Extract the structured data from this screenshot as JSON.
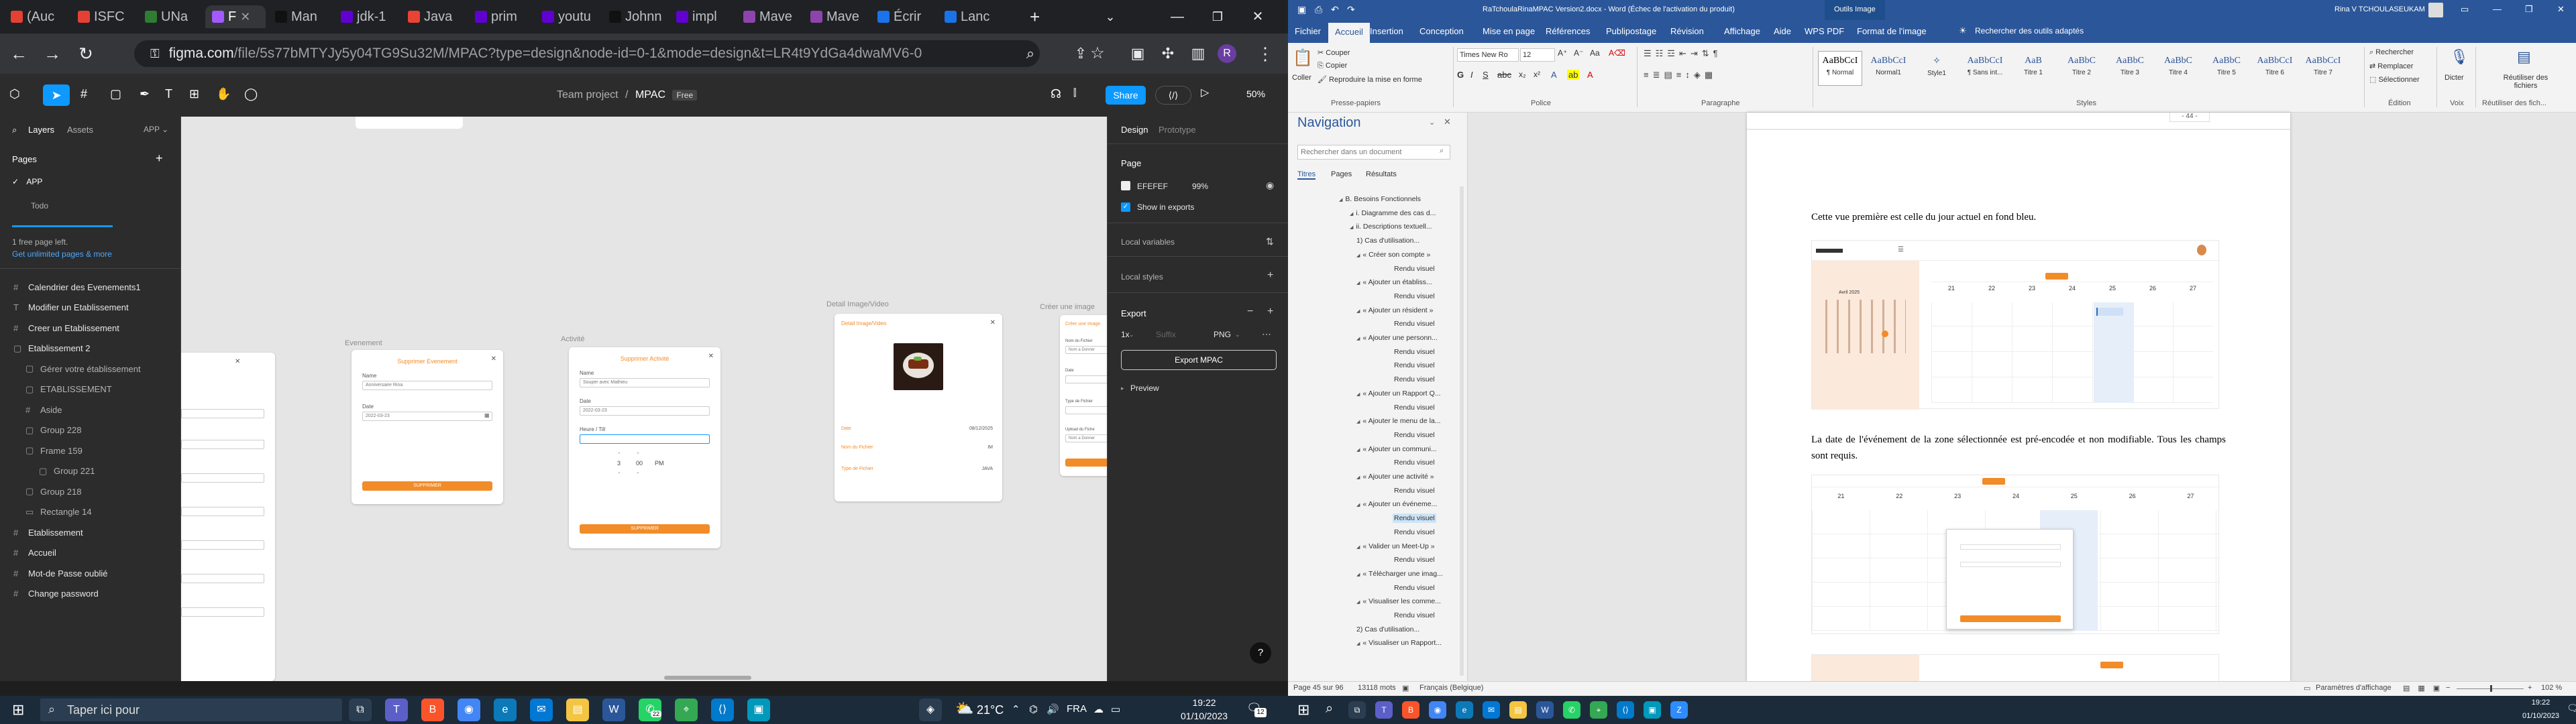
{
  "chrome": {
    "tabs": [
      {
        "label": "(Auc",
        "color": "#e44134"
      },
      {
        "label": "ISFC",
        "color": "#e44134"
      },
      {
        "label": "UNa",
        "color": "#2e7d32"
      },
      {
        "label": "F",
        "color": "#a259ff"
      },
      {
        "label": "Man",
        "color": "#111111"
      },
      {
        "label": "jdk-1",
        "color": "#6001d2"
      },
      {
        "label": "Java",
        "color": "#ea4335"
      },
      {
        "label": "prim",
        "color": "#6001d2"
      },
      {
        "label": "youtu",
        "color": "#6001d2"
      },
      {
        "label": "Johnn",
        "color": "#111111"
      },
      {
        "label": "impl",
        "color": "#6001d2"
      },
      {
        "label": "Mave",
        "color": "#8e44ad"
      },
      {
        "label": "Mave",
        "color": "#8e44ad"
      },
      {
        "label": "Écrir",
        "color": "#1a73e8"
      },
      {
        "label": "Lanc",
        "color": "#1a73e8"
      }
    ],
    "new_tab": "+",
    "url_main": "figma.com",
    "url_rest": "/file/5s77bMTYJy5y04TG9Su32M/MPAC?type=design&node-id=0-1&mode=design&t=LR4t9YdGa4dwaMV6-0",
    "window_min": "—",
    "window_max": "❐",
    "window_close": "✕"
  },
  "figma": {
    "breadcrumb_team": "Team project",
    "breadcrumb_sep": "/",
    "file_name": "MPAC",
    "plan_badge": "Free",
    "share_label": "Share",
    "avatar_letter": "Y",
    "zoom": "50%",
    "left": {
      "tab_layers": "Layers",
      "tab_assets": "Assets",
      "app_select": "APP",
      "pages_title": "Pages",
      "pages": [
        "APP",
        "Todo"
      ],
      "free_left": "1 free page left.",
      "upgrade_link": "Get unlimited pages & more",
      "layers": [
        {
          "label": "Calendrier des Evenements1",
          "level": 0
        },
        {
          "label": "Modifier un Etablissement",
          "level": 0
        },
        {
          "label": "Creer un Etablissement",
          "level": 0
        },
        {
          "label": "Etablissement 2",
          "level": 0
        },
        {
          "label": "Gérer votre établissement",
          "level": 1
        },
        {
          "label": "ETABLISSEMENT",
          "level": 1
        },
        {
          "label": "Aside",
          "level": 1
        },
        {
          "label": "Group 228",
          "level": 1
        },
        {
          "label": "Frame 159",
          "level": 1
        },
        {
          "label": "Group 221",
          "level": 2
        },
        {
          "label": "Group 218",
          "level": 1
        },
        {
          "label": "Rectangle 14",
          "level": 1
        },
        {
          "label": "Etablissement",
          "level": 0
        },
        {
          "label": "Accueil",
          "level": 0
        },
        {
          "label": "Mot-de Passe oublié",
          "level": 0
        },
        {
          "label": "Change password",
          "level": 0
        }
      ]
    },
    "canvas": {
      "frame_evenement": "Evenement",
      "frame_activite": "Activité",
      "frame_detail": "Detail Image/Video",
      "frame_creer": "Créer une image",
      "modal_event": {
        "title": "Supprimer Evenement",
        "name_label": "Name",
        "name_value": "Anniversaire Rina",
        "date_label": "Date",
        "date_value": "2022-03-23",
        "button": "SUPPRIMER"
      },
      "modal_activite": {
        "title": "Supprimer Activité",
        "name_label": "Name",
        "name_value": "Souper avec Mathieu",
        "date_label": "Date",
        "date_value": "2022-03-23",
        "hour_label": "Heure / Till",
        "time_h": "3",
        "time_m": "00",
        "time_p": "PM",
        "button": "SUPPRIMER"
      },
      "detail": {
        "title": "Detail Image/Video",
        "date_label": "Date",
        "date_value": "08/12/2025",
        "nom_label": "Nom du Fichier",
        "nom_value": "IM",
        "type_label": "Type de Fichier",
        "type_value": "JAVA"
      },
      "creer": {
        "title": "Créer une image",
        "nom_label": "Nom du Fichier",
        "nom_placeholder": "Nom a Donner",
        "date_label": "Date",
        "type_label": "Type de Fichier",
        "upload_label": "Upload du Fiche",
        "upload_placeholder": "Nom a Donner"
      }
    },
    "right": {
      "tab_design": "Design",
      "tab_prototype": "Prototype",
      "page_title": "Page",
      "page_color": "EFEFEF",
      "page_opacity": "99%",
      "show_exports": "Show in exports",
      "local_variables": "Local variables",
      "local_styles": "Local styles",
      "export_title": "Export",
      "export_scale": "1x",
      "export_suffix": "Suffix",
      "export_format": "PNG",
      "export_button": "Export MPAC",
      "preview": "Preview",
      "help": "?"
    }
  },
  "taskbar": {
    "search_placeholder": "Taper ici pour",
    "weather": "21°C",
    "lang": "FRA",
    "time_left": "19:22",
    "date_left": "01/10/2023",
    "notif_count": "22",
    "notif_badge": "12",
    "time_right": "19:22",
    "date_right": "01/10/2023"
  },
  "word": {
    "title": "RaTchoulaRinaMPAC Version2.docx - Word (Échec de l'activation du produit)",
    "context_tab": "Outils Image",
    "user_name": "Rina V TCHOULASEUKAM",
    "tabs": [
      "Fichier",
      "Accueil",
      "Insertion",
      "Conception",
      "Mise en page",
      "Références",
      "Publipostage",
      "Révision",
      "Affichage",
      "Aide",
      "WPS PDF",
      "Format de l'image"
    ],
    "tell_me": "Rechercher des outils adaptés",
    "ribbon": {
      "paste": "Coller",
      "cut": "Couper",
      "copy": "Copier",
      "format_painter": "Reproduire la mise en forme",
      "clipboard": "Presse-papiers",
      "font_name": "Times New Ro",
      "font_size": "12",
      "font_group": "Police",
      "para_group": "Paragraphe",
      "styles_group": "Styles",
      "edit_group": "Édition",
      "voice_group": "Voix",
      "reuse_group": "Réutiliser des fich...",
      "find": "Rechercher",
      "replace": "Remplacer",
      "select": "Sélectionner",
      "dictate": "Dicter",
      "reuse": "Réutiliser des fichiers",
      "styles": [
        {
          "sample": "AaBbCcI",
          "name": "¶ Normal"
        },
        {
          "sample": "AaBbCcI",
          "name": "Normal1"
        },
        {
          "sample": "✧",
          "name": "Style1"
        },
        {
          "sample": "AaBbCcI",
          "name": "¶ Sans int..."
        },
        {
          "sample": "AaB",
          "name": "Titre 1"
        },
        {
          "sample": "AaBbC",
          "name": "Titre 2"
        },
        {
          "sample": "AaBbC",
          "name": "Titre 3"
        },
        {
          "sample": "AaBbC",
          "name": "Titre 4"
        },
        {
          "sample": "AaBbC",
          "name": "Titre 5"
        },
        {
          "sample": "AaBbCcI",
          "name": "Titre 6"
        },
        {
          "sample": "AaBbCcI",
          "name": "Titre 7"
        }
      ]
    },
    "nav": {
      "title": "Navigation",
      "search_placeholder": "Rechercher dans un document",
      "tab_titles": "Titres",
      "tab_pages": "Pages",
      "tab_results": "Résultats",
      "items": [
        {
          "label": "B. Besoins Fonctionnels",
          "level": 1
        },
        {
          "label": "i. Diagramme des cas d...",
          "level": 2
        },
        {
          "label": "ii. Descriptions textuell...",
          "level": 2
        },
        {
          "label": "1) Cas d'utilisation...",
          "level": 3
        },
        {
          "label": "« Créer son compte »",
          "level": 3
        },
        {
          "label": "Rendu visuel",
          "level": 4
        },
        {
          "label": "« Ajouter un établiss...",
          "level": 3
        },
        {
          "label": "Rendu visuel",
          "level": 4
        },
        {
          "label": "« Ajouter un résident »",
          "level": 3
        },
        {
          "label": "Rendu visuel",
          "level": 4
        },
        {
          "label": "« Ajouter une personn...",
          "level": 3
        },
        {
          "label": "Rendu visuel",
          "level": 4
        },
        {
          "label": "Rendu visuel",
          "level": 4
        },
        {
          "label": "Rendu visuel",
          "level": 4
        },
        {
          "label": "« Ajouter un Rapport Q...",
          "level": 3
        },
        {
          "label": "Rendu visuel",
          "level": 4
        },
        {
          "label": "« Ajouter le menu de la...",
          "level": 3
        },
        {
          "label": "Rendu visuel",
          "level": 4
        },
        {
          "label": "« Ajouter un communi...",
          "level": 3
        },
        {
          "label": "Rendu visuel",
          "level": 4
        },
        {
          "label": "« Ajouter une activité »",
          "level": 3
        },
        {
          "label": "Rendu visuel",
          "level": 4
        },
        {
          "label": "« Ajouter un événeme...",
          "level": 3
        },
        {
          "label": "Rendu visuel",
          "level": 4,
          "highlight": true
        },
        {
          "label": "Rendu visuel",
          "level": 4
        },
        {
          "label": "« Valider un Meet-Up »",
          "level": 3
        },
        {
          "label": "Rendu visuel",
          "level": 4
        },
        {
          "label": "« Télécharger une imag...",
          "level": 3
        },
        {
          "label": "Rendu visuel",
          "level": 4
        },
        {
          "label": "« Visualiser les comme...",
          "level": 3
        },
        {
          "label": "Rendu visuel",
          "level": 4
        },
        {
          "label": "2) Cas d'utilisation...",
          "level": 3
        },
        {
          "label": "« Visualiser un Rapport...",
          "level": 3
        }
      ]
    },
    "doc": {
      "page_number": "- 44 -",
      "para1": "Cette vue première est celle du jour actuel en fond bleu.",
      "para2": "La date de l'événement de la zone sélectionnée est pré-encodée et non modifiable. Tous les champs sont requis.",
      "cal_month": "Avril 2025",
      "cal_days": [
        "21",
        "22",
        "23",
        "24",
        "25",
        "26",
        "27"
      ]
    },
    "status": {
      "page": "Page 45 sur 96",
      "words": "13118 mots",
      "lang": "Français (Belgique)",
      "display_settings": "Paramètres d'affichage",
      "zoom": "102 %"
    }
  },
  "colors": {
    "figma_dark": "#2c2c2c",
    "figma_canvas": "#e5e5e5",
    "figma_blue": "#0d99ff",
    "accent_orange": "#f28c28",
    "word_blue": "#2b579a",
    "taskbar": "#1c2b3a"
  }
}
